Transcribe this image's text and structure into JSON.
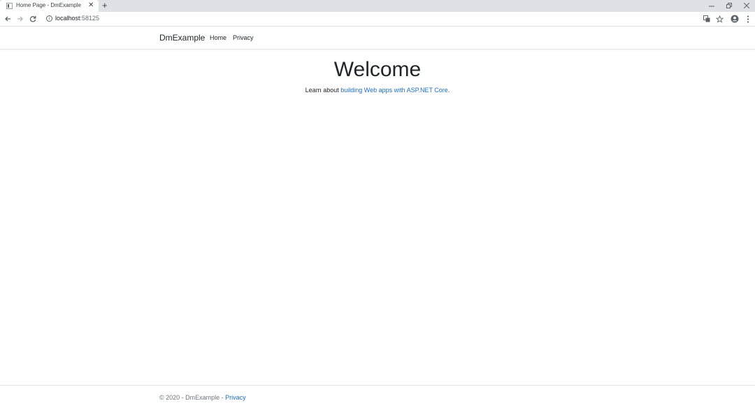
{
  "browser": {
    "tab_title": "Home Page - DmExample",
    "tab_close": "✕",
    "new_tab": "+",
    "url_host": "localhost",
    "url_port": ":58125",
    "icons": {
      "back": "back-arrow-icon",
      "forward": "forward-arrow-icon",
      "reload": "reload-icon",
      "info": "info-icon",
      "translate": "translate-icon",
      "bookmark": "star-icon",
      "profile": "account-icon",
      "menu": "kebab-menu-icon"
    }
  },
  "header": {
    "brand": "DmExample",
    "nav": [
      {
        "label": "Home"
      },
      {
        "label": "Privacy"
      }
    ]
  },
  "main": {
    "title": "Welcome",
    "lead_prefix": "Learn about ",
    "lead_link": "building Web apps with ASP.NET Core",
    "lead_suffix": "."
  },
  "footer": {
    "text": "© 2020 - DmExample - ",
    "privacy_link": "Privacy"
  },
  "colors": {
    "link": "#1b6ec2",
    "tabstrip": "#dee1e6"
  }
}
